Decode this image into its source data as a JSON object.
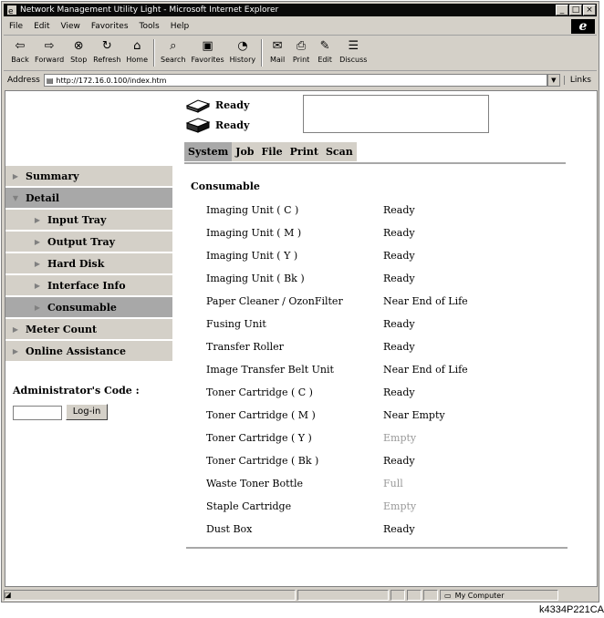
{
  "window": {
    "title": "Network Management Utility Light - Microsoft Internet Explorer",
    "controls": [
      "_",
      "□",
      "×"
    ]
  },
  "menu": [
    "File",
    "Edit",
    "View",
    "Favorites",
    "Tools",
    "Help"
  ],
  "toolbar": [
    {
      "label": "Back",
      "icon": "back-arrow-icon"
    },
    {
      "label": "Forward",
      "icon": "forward-arrow-icon"
    },
    {
      "label": "Stop",
      "icon": "stop-icon"
    },
    {
      "label": "Refresh",
      "icon": "refresh-icon"
    },
    {
      "label": "Home",
      "icon": "home-icon"
    },
    {
      "label": "Search",
      "icon": "search-icon"
    },
    {
      "label": "Favorites",
      "icon": "favorites-icon"
    },
    {
      "label": "History",
      "icon": "history-icon"
    },
    {
      "label": "Mail",
      "icon": "mail-icon"
    },
    {
      "label": "Print",
      "icon": "print-icon"
    },
    {
      "label": "Edit",
      "icon": "edit-icon"
    },
    {
      "label": "Discuss",
      "icon": "discuss-icon"
    }
  ],
  "address": {
    "label": "Address",
    "url": "http://172.16.0.100/index.htm",
    "links": "Links"
  },
  "device_status": [
    {
      "text": "Ready",
      "icon": "printer-icon"
    },
    {
      "text": "Ready",
      "icon": "scanner-icon"
    }
  ],
  "tabs": [
    "System",
    "Job",
    "File",
    "Print",
    "Scan"
  ],
  "active_tab": "System",
  "nav": [
    {
      "label": "Summary",
      "level": 0,
      "state": "normal"
    },
    {
      "label": "Detail",
      "level": 0,
      "state": "expanded"
    },
    {
      "label": "Input Tray",
      "level": 1,
      "state": "normal"
    },
    {
      "label": "Output Tray",
      "level": 1,
      "state": "normal"
    },
    {
      "label": "Hard Disk",
      "level": 1,
      "state": "normal"
    },
    {
      "label": "Interface Info",
      "level": 1,
      "state": "normal"
    },
    {
      "label": "Consumable",
      "level": 1,
      "state": "selected"
    },
    {
      "label": "Meter Count",
      "level": 0,
      "state": "normal"
    },
    {
      "label": "Online Assistance",
      "level": 0,
      "state": "normal"
    }
  ],
  "admin": {
    "label": "Administrator's Code :",
    "button": "Log-in",
    "value": ""
  },
  "section_title": "Consumable",
  "consumables": [
    {
      "name": "Imaging Unit ( C )",
      "status": "Ready",
      "muted": false
    },
    {
      "name": "Imaging Unit ( M )",
      "status": "Ready",
      "muted": false
    },
    {
      "name": "Imaging Unit ( Y )",
      "status": "Ready",
      "muted": false
    },
    {
      "name": "Imaging Unit ( Bk )",
      "status": "Ready",
      "muted": false
    },
    {
      "name": "Paper Cleaner / OzonFilter",
      "status": "Near End of Life",
      "muted": false
    },
    {
      "name": "Fusing Unit",
      "status": "Ready",
      "muted": false
    },
    {
      "name": "Transfer Roller",
      "status": "Ready",
      "muted": false
    },
    {
      "name": "Image Transfer Belt Unit",
      "status": "Near End of Life",
      "muted": false
    },
    {
      "name": "Toner Cartridge ( C )",
      "status": "Ready",
      "muted": false
    },
    {
      "name": "Toner Cartridge ( M )",
      "status": "Near Empty",
      "muted": false
    },
    {
      "name": "Toner Cartridge ( Y )",
      "status": "Empty",
      "muted": true
    },
    {
      "name": "Toner Cartridge ( Bk )",
      "status": "Ready",
      "muted": false
    },
    {
      "name": "Waste Toner Bottle",
      "status": "Full",
      "muted": true
    },
    {
      "name": "Staple Cartridge",
      "status": "Empty",
      "muted": true
    },
    {
      "name": "Dust Box",
      "status": "Ready",
      "muted": false
    }
  ],
  "statusbar": {
    "zone": "My Computer"
  },
  "caption": "k4334P221CA",
  "colors": {
    "nav_bg": "#d4d0c8",
    "nav_selected": "#a8a8a8",
    "muted_text": "#999999"
  }
}
